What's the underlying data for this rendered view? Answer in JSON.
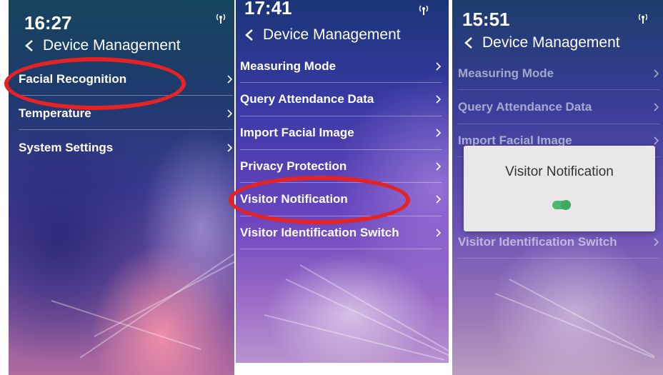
{
  "panels": [
    {
      "time": "16:27",
      "header": {
        "back_symbol": "<",
        "title": "Device Management"
      },
      "menu": [
        {
          "label": "Facial Recognition",
          "circled": true
        },
        {
          "label": "Temperature"
        },
        {
          "label": "System Settings"
        }
      ]
    },
    {
      "time": "17:41",
      "header": {
        "back_symbol": "<",
        "title": "Device Management"
      },
      "menu": [
        {
          "label": "Measuring Mode"
        },
        {
          "label": "Query Attendance Data"
        },
        {
          "label": "Import Facial Image"
        },
        {
          "label": "Privacy Protection"
        },
        {
          "label": "Visitor Notification",
          "circled": true
        },
        {
          "label": "Visitor Identification Switch"
        }
      ]
    },
    {
      "time": "15:51",
      "header": {
        "back_symbol": "<",
        "title": "Device Management"
      },
      "menu": [
        {
          "label": "Measuring Mode"
        },
        {
          "label": "Query Attendance Data"
        },
        {
          "label": "Import Facial Image"
        },
        {
          "label": "Visitor Identification Switch"
        }
      ],
      "dialog": {
        "title": "Visitor Notification",
        "toggle_on": true
      }
    }
  ],
  "colors": {
    "highlight_ring": "#e52224",
    "toggle_on": "#4ab86f"
  },
  "icons": [
    "back-arrow-icon",
    "chevron-right-icon",
    "wifi-signal-icon"
  ]
}
